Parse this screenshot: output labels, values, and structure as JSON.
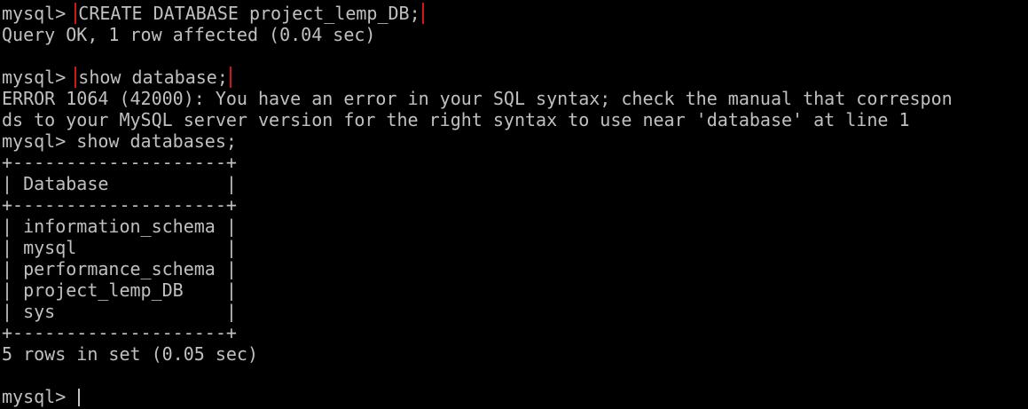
{
  "terminal": {
    "prompt": "mysql> ",
    "cmd1": "CREATE DATABASE project_lemp_DB;",
    "out1": "Query OK, 1 row affected (0.04 sec)",
    "cmd2": "show database;",
    "err1": "ERROR 1064 (42000): You have an error in your SQL syntax; check the manual that correspon",
    "err2": "ds to your MySQL server version for the right syntax to use near 'database' at line 1",
    "cmd3": "show databases;",
    "table_border": "+--------------------+",
    "table_header": "| Database           |",
    "table_rows": [
      "| information_schema |",
      "| mysql              |",
      "| performance_schema |",
      "| project_lemp_DB    |",
      "| sys                |"
    ],
    "out3": "5 rows in set (0.05 sec)",
    "highlight_color": "#d01818"
  }
}
